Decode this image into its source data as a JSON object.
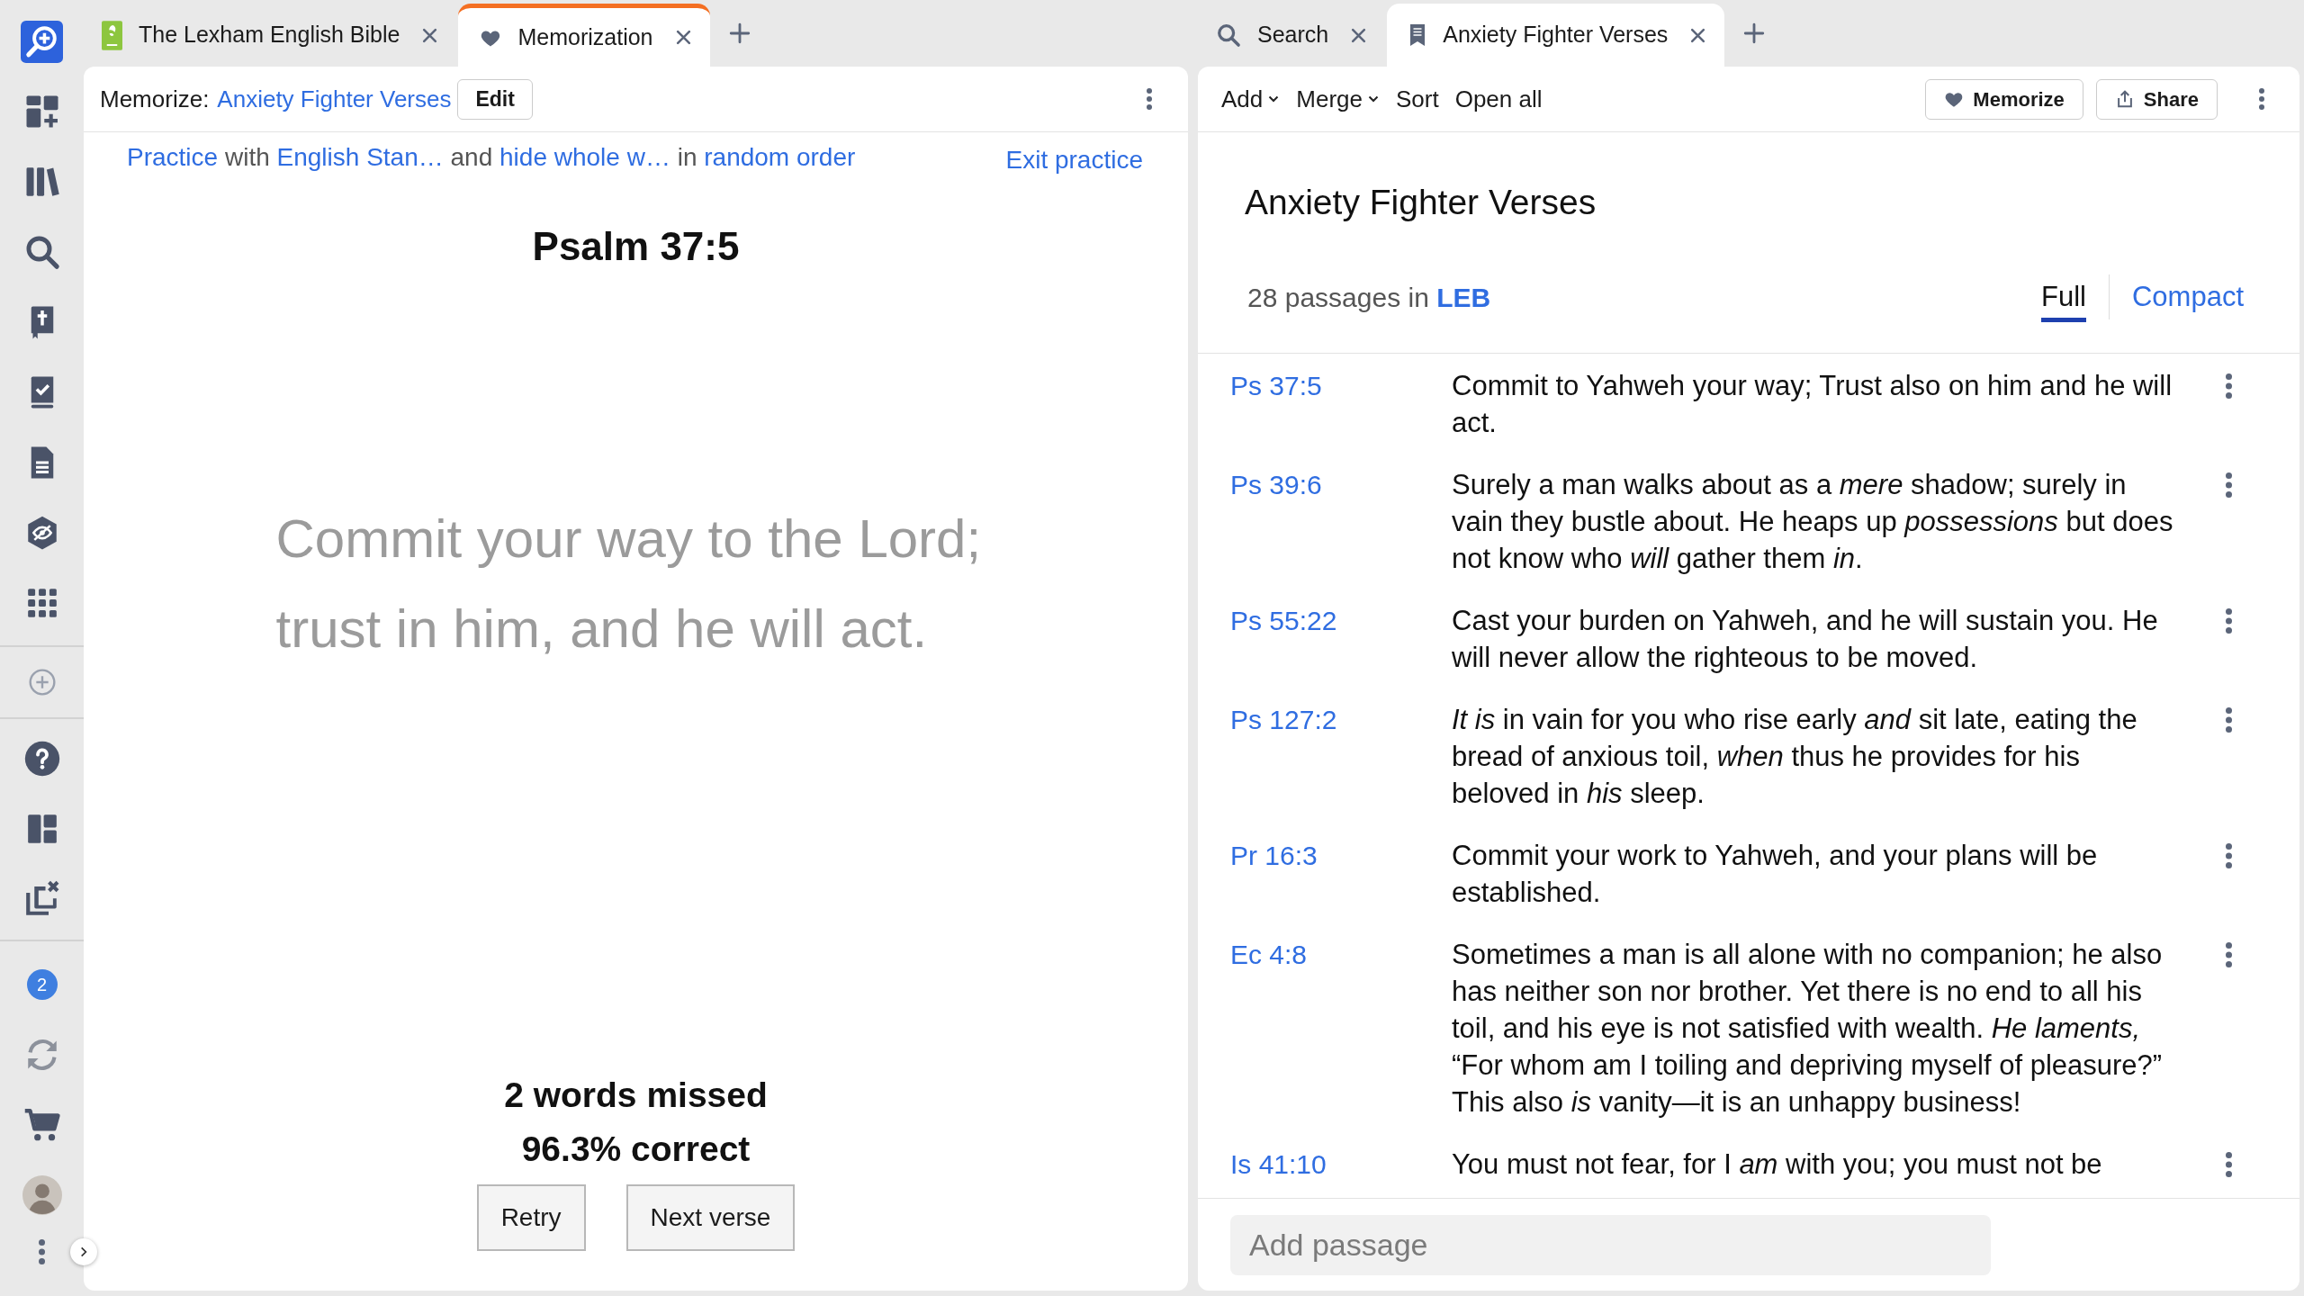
{
  "sidebar": {
    "notification_count": "2"
  },
  "memorization_pane": {
    "focused": true,
    "tabs": [
      {
        "label": "The Lexham English Bible",
        "kind": "book",
        "selected": false
      },
      {
        "label": "Memorization",
        "kind": "memorize",
        "selected": true
      }
    ],
    "toolbar": {
      "label": "Memorize:",
      "list_link": "Anxiety Fighter Verses",
      "edit_button": "Edit"
    },
    "practice_settings": {
      "segments": [
        {
          "text": "Practice",
          "kind": "link"
        },
        {
          "text": "with",
          "kind": "text"
        },
        {
          "text": "English Stan…",
          "kind": "link"
        },
        {
          "text": "and",
          "kind": "text"
        },
        {
          "text": "hide whole w…",
          "kind": "link"
        },
        {
          "text": "in",
          "kind": "text"
        },
        {
          "text": "random order",
          "kind": "link"
        }
      ],
      "exit_link": "Exit practice"
    },
    "reference": "Psalm 37:5",
    "verse_text": "Commit your way to the Lord; trust in him, and he will act.",
    "result": {
      "missed": "2 words missed",
      "score": "96.3% correct"
    },
    "buttons": [
      "Retry",
      "Next verse"
    ]
  },
  "passage_list_pane": {
    "focused": false,
    "tabs": [
      {
        "label": "Search",
        "kind": "search",
        "selected": false
      },
      {
        "label": "Anxiety Fighter Verses",
        "kind": "list",
        "selected": true
      }
    ],
    "toolbar": {
      "menus": [
        {
          "label": "Add",
          "kind": "dropdown"
        },
        {
          "label": "Merge",
          "kind": "dropdown"
        },
        {
          "label": "Sort",
          "kind": "plain"
        },
        {
          "label": "Open all",
          "kind": "plain"
        }
      ],
      "buttons": [
        {
          "label": "Memorize",
          "kind": "heart"
        },
        {
          "label": "Share",
          "kind": "share"
        }
      ]
    },
    "title": "Anxiety Fighter Verses",
    "summary": {
      "text": "28 passages in",
      "version": "LEB"
    },
    "views": [
      {
        "label": "Full",
        "selected": true
      },
      {
        "label": "Compact",
        "selected": false
      }
    ],
    "passages": [
      {
        "reference": "Ps 37:5",
        "text": "Commit to Yahweh your way; Trust also on him and he will act."
      },
      {
        "reference": "Ps 39:6",
        "text": "Surely a man walks about as a *mere* shadow; surely in vain they bustle about. He heaps up *possessions* but does not know who *will* gather them *in*."
      },
      {
        "reference": "Ps 55:22",
        "text": "Cast your burden on Yahweh, and he will sustain you. He will never allow the righteous to be moved."
      },
      {
        "reference": "Ps 127:2",
        "text": "*It is* in vain for you who rise early *and* sit late, eating the bread of anxious toil, *when* thus he provides for his beloved in *his* sleep."
      },
      {
        "reference": "Pr 16:3",
        "text": "Commit your work to Yahweh, and your plans will be established."
      },
      {
        "reference": "Ec 4:8",
        "text": "Sometimes a man is all alone with no companion; he also has neither son nor brother. Yet there is no end to all his toil, and his eye is not satisfied with wealth. *He laments,* “For whom am I toiling and depriving myself of pleasure?” This also *is* vanity—it is an unhappy business!"
      },
      {
        "reference": "Is 41:10",
        "text": "You must not fear, for I *am* with you; you must not be"
      }
    ],
    "add_passage": {
      "placeholder": "Add passage"
    }
  }
}
